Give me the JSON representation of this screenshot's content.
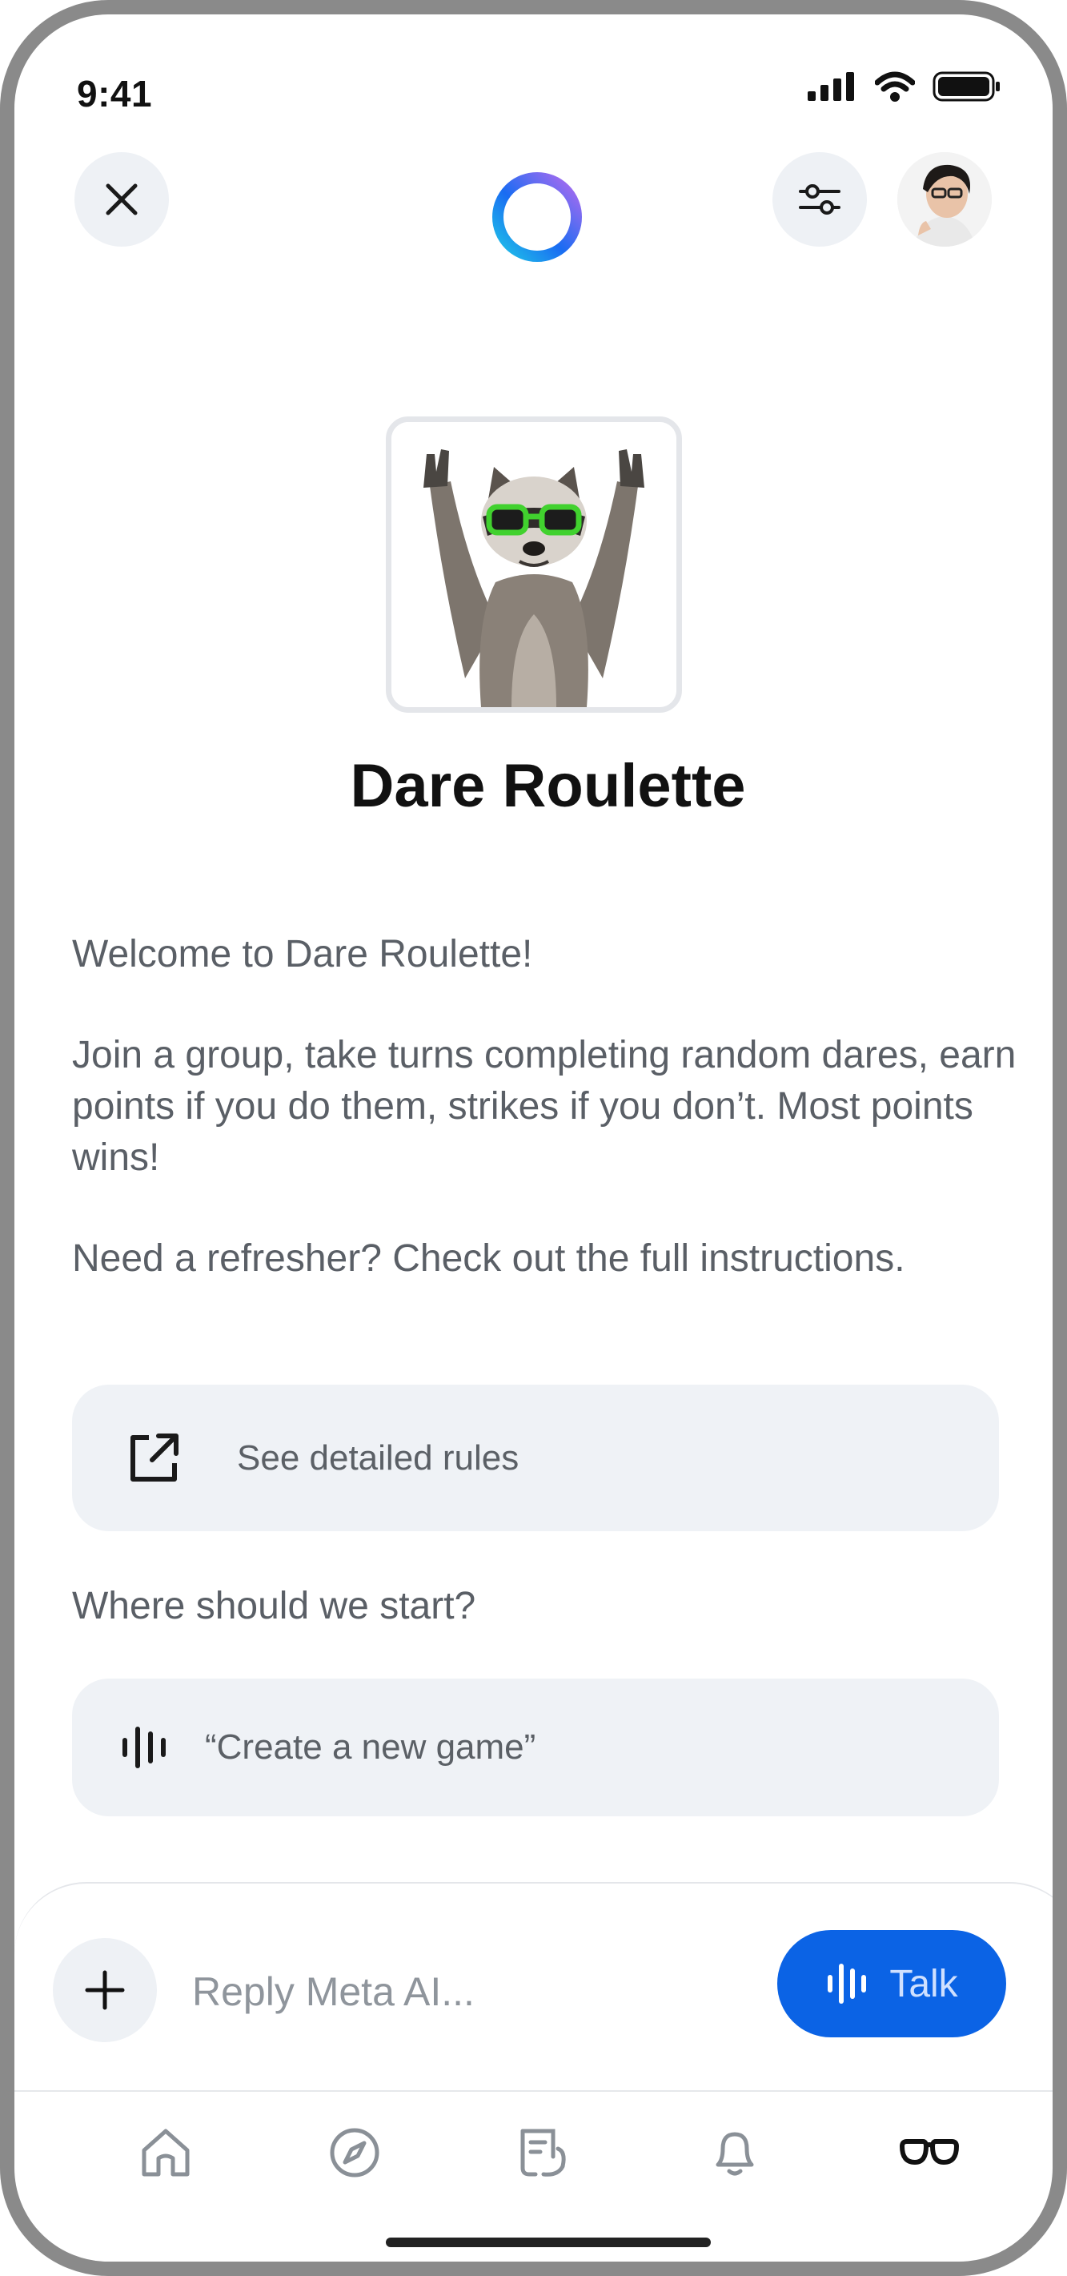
{
  "status_bar": {
    "time": "9:41"
  },
  "header": {
    "close_icon": "close-icon",
    "logo": "meta-ai-ring-logo",
    "filter_icon": "sliders-icon",
    "avatar": "user-avatar"
  },
  "hero": {
    "title": "Dare Roulette",
    "image": "raccoon-with-green-sunglasses"
  },
  "message": {
    "welcome": "Welcome to Dare Roulette!",
    "description": "Join a group, take turns completing random dares, earn points if you do them, strikes if you don’t. Most points wins!",
    "refresher": "Need a refresher? Check out the full instructions.",
    "rules_button": "See detailed rules",
    "start_prompt": "Where should we start?",
    "suggestion": "“Create a new game”"
  },
  "composer": {
    "placeholder": "Reply Meta AI...",
    "talk_label": "Talk"
  },
  "bottom_nav": {
    "items": [
      "home-icon",
      "compass-icon",
      "feed-icon",
      "bell-icon",
      "glasses-icon"
    ],
    "active": "glasses-icon"
  },
  "colors": {
    "accent": "#0b63e5",
    "card_bg": "#eff2f6",
    "text_muted": "#5a5f66"
  }
}
